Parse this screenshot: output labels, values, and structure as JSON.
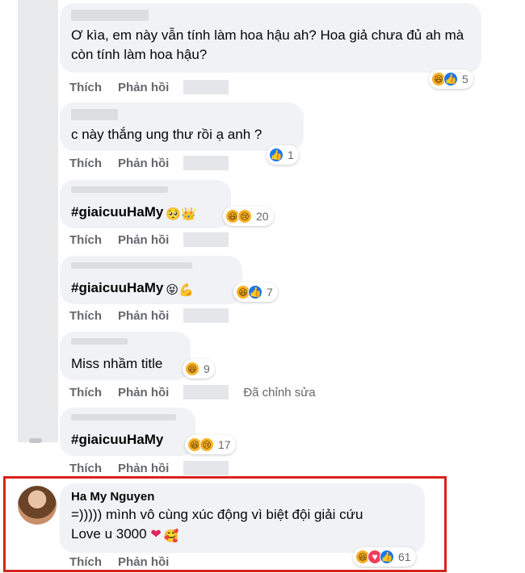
{
  "actions": {
    "like": "Thích",
    "reply": "Phản hồi",
    "edited": "Đã chỉnh sửa"
  },
  "comments": [
    {
      "text": "Ơ kìa, em này vẫn tính làm hoa hậu ah? Hoa giả chưa đủ ah mà còn tính làm hoa hậu?",
      "reactions": [
        "haha",
        "like"
      ],
      "count": "5"
    },
    {
      "text": "c này thắng ung thư rồi ạ anh ?",
      "reactions": [
        "like"
      ],
      "count": "1"
    },
    {
      "text": "#giaicuuHaMy",
      "emojis": "🥺👑",
      "reactions": [
        "haha",
        "sad"
      ],
      "count": "20"
    },
    {
      "text": "#giaicuuHaMy",
      "emojis": "😝💪",
      "reactions": [
        "haha",
        "like"
      ],
      "count": "7"
    },
    {
      "text": "Miss nhầm title",
      "reactions": [
        "haha"
      ],
      "count": "9"
    },
    {
      "text": "#giaicuuHaMy",
      "reactions": [
        "haha",
        "sad"
      ],
      "count": "17"
    }
  ],
  "highlighted": {
    "author": "Ha My Nguyen",
    "line1": "=))))) mình vô cùng xúc động vì biệt đội giải cứu",
    "line2": "Love u 3000",
    "emojis": "🥰",
    "reactions": [
      "haha",
      "love",
      "like"
    ],
    "count": "61"
  },
  "colors": {
    "highlight_border": "#d8231c",
    "bubble": "#f0f2f5",
    "secondary_text": "#65676b",
    "like_blue": "#1877f2",
    "haha_yellow": "#f7b125"
  }
}
